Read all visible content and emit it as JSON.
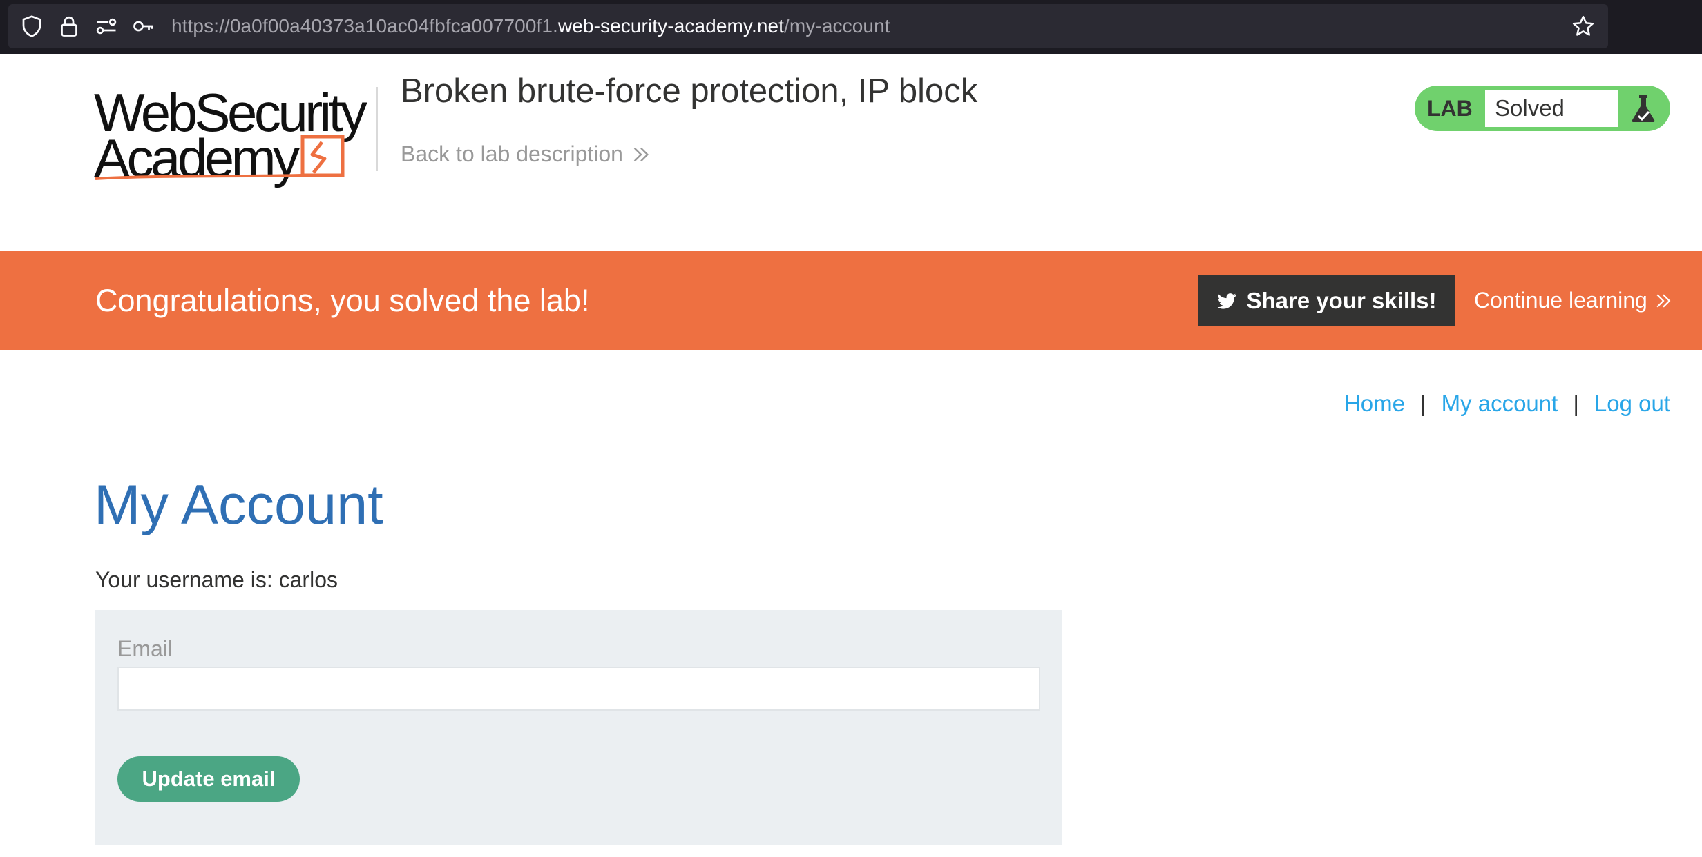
{
  "browser": {
    "url_prefix": "https://0a0f00a40373a10ac04fbfca007700f1.",
    "url_host": "web-security-academy.net",
    "url_path": "/my-account"
  },
  "header": {
    "logo_line1": "WebSecurity",
    "logo_line2": "Academy",
    "lab_title": "Broken brute-force protection, IP block",
    "back_link": "Back to lab description",
    "lab_badge": "LAB",
    "lab_status": "Solved"
  },
  "banner": {
    "message": "Congratulations, you solved the lab!",
    "share_button": "Share your skills!",
    "continue_link": "Continue learning"
  },
  "nav": {
    "home": "Home",
    "my_account": "My account",
    "log_out": "Log out",
    "separator": "|"
  },
  "main": {
    "title": "My Account",
    "username_line": "Your username is: carlos",
    "email_label": "Email",
    "email_value": "",
    "update_button": "Update email"
  },
  "colors": {
    "banner": "#ee7041",
    "lab_solved": "#70d16d",
    "link": "#29a6e8",
    "title": "#2f6fb4",
    "button": "#4ba684"
  }
}
